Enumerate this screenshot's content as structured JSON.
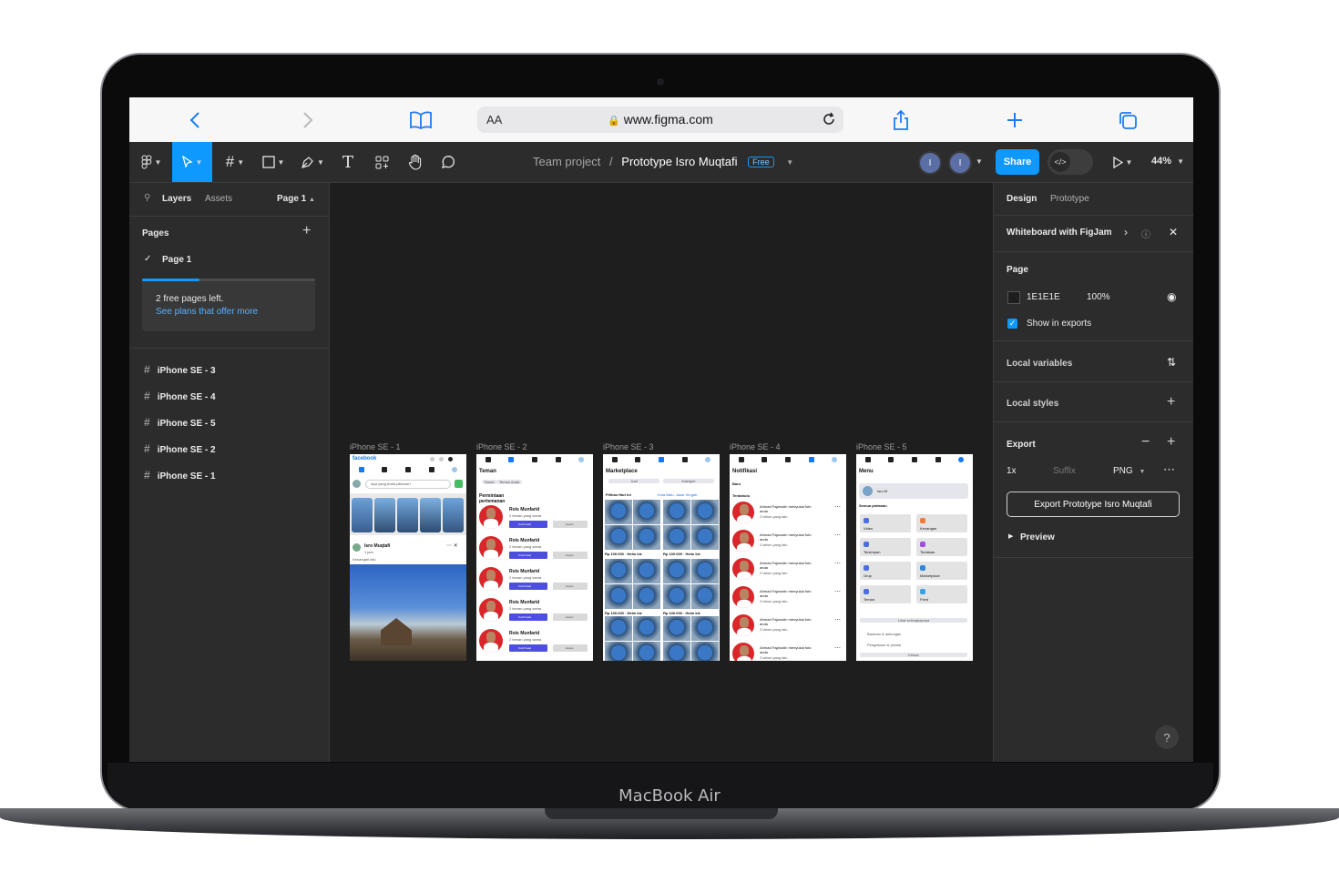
{
  "device": {
    "brand_label": "MacBook Air"
  },
  "browser": {
    "url": "www.figma.com",
    "text_size_label": "AA"
  },
  "toolbar": {
    "breadcrumb_team": "Team project",
    "breadcrumb_sep": "/",
    "file_name": "Prototype Isro Muqtafi",
    "plan_badge": "Free",
    "avatar1_initial": "I",
    "avatar2_initial": "I",
    "share_label": "Share",
    "devmode_label": "</>",
    "zoom": "44%"
  },
  "left_panel": {
    "tab_layers": "Layers",
    "tab_assets": "Assets",
    "page_selector": "Page 1",
    "pages_heading": "Pages",
    "current_page": "Page 1",
    "promo_title": "2 free pages left.",
    "promo_link": "See plans that offer more",
    "promo_progress": 0.33,
    "frames": [
      "iPhone SE - 3",
      "iPhone SE - 4",
      "iPhone SE - 5",
      "iPhone SE - 2",
      "iPhone SE - 1"
    ]
  },
  "canvas": {
    "frames": [
      {
        "label": "iPhone SE - 1"
      },
      {
        "label": "iPhone SE - 2"
      },
      {
        "label": "iPhone SE - 3"
      },
      {
        "label": "iPhone SE - 4"
      },
      {
        "label": "iPhone SE - 5"
      }
    ],
    "feed": {
      "logo": "facebook",
      "search_placeholder": "Apa yang Anda pikirkan?",
      "post_author": "Isro Muqtafi",
      "post_meta": "1 jam",
      "post_caption": "Kenangan lalu"
    },
    "friends": {
      "title": "Teman",
      "chip1": "Saran",
      "chip2": "Teman Anda",
      "section": "Permintaan pertemanan",
      "name": "Rois Munfarid",
      "mutual": "2 teman yang sama",
      "confirm": "Konfirmasi",
      "remove": "Hapus"
    },
    "marketplace": {
      "title": "Marketplace",
      "sell": "Jual",
      "category": "Kategori",
      "picks": "Pilihan Hari Ini",
      "location": "Kota Batu, Jawa Tengah",
      "price": "Rp 100.000 · Helm kie"
    },
    "notifications": {
      "title": "Notifikasi",
      "new_label": "Baru",
      "earlier_label": "Terdahulu",
      "item_text": "Ahmad Fajarudin menyukai foto anda",
      "item_time": "2 tahun yang lalu"
    },
    "menu": {
      "title": "Menu",
      "profile_name": "Isro M",
      "shortcuts_label": "Semua pintasan",
      "tiles": [
        "Video",
        "Kenangan",
        "Tersimpan",
        "Tindakan",
        "Grup",
        "Marketplace",
        "Teman",
        "Feed"
      ],
      "see_more": "Lihat selengkapnya",
      "help": "Bantuan & dukungan",
      "settings": "Pengaturan & privasi",
      "logout": "Keluar"
    }
  },
  "right_panel": {
    "tab_design": "Design",
    "tab_prototype": "Prototype",
    "whiteboard_label": "Whiteboard with FigJam",
    "page_heading": "Page",
    "page_color": "1E1E1E",
    "page_opacity": "100%",
    "show_in_exports": "Show in exports",
    "local_variables": "Local variables",
    "local_styles": "Local styles",
    "export_heading": "Export",
    "export_scale": "1x",
    "export_suffix_placeholder": "Suffix",
    "export_format": "PNG",
    "export_button": "Export Prototype Isro Muqtafi",
    "preview_label": "Preview",
    "help_label": "?"
  },
  "colors": {
    "figma_blue": "#0d99ff",
    "panel_bg": "#2c2c2c",
    "canvas_bg": "#1e1e1e",
    "confirm_purple": "#4d4de0",
    "avatar_red": "#d8262a"
  }
}
